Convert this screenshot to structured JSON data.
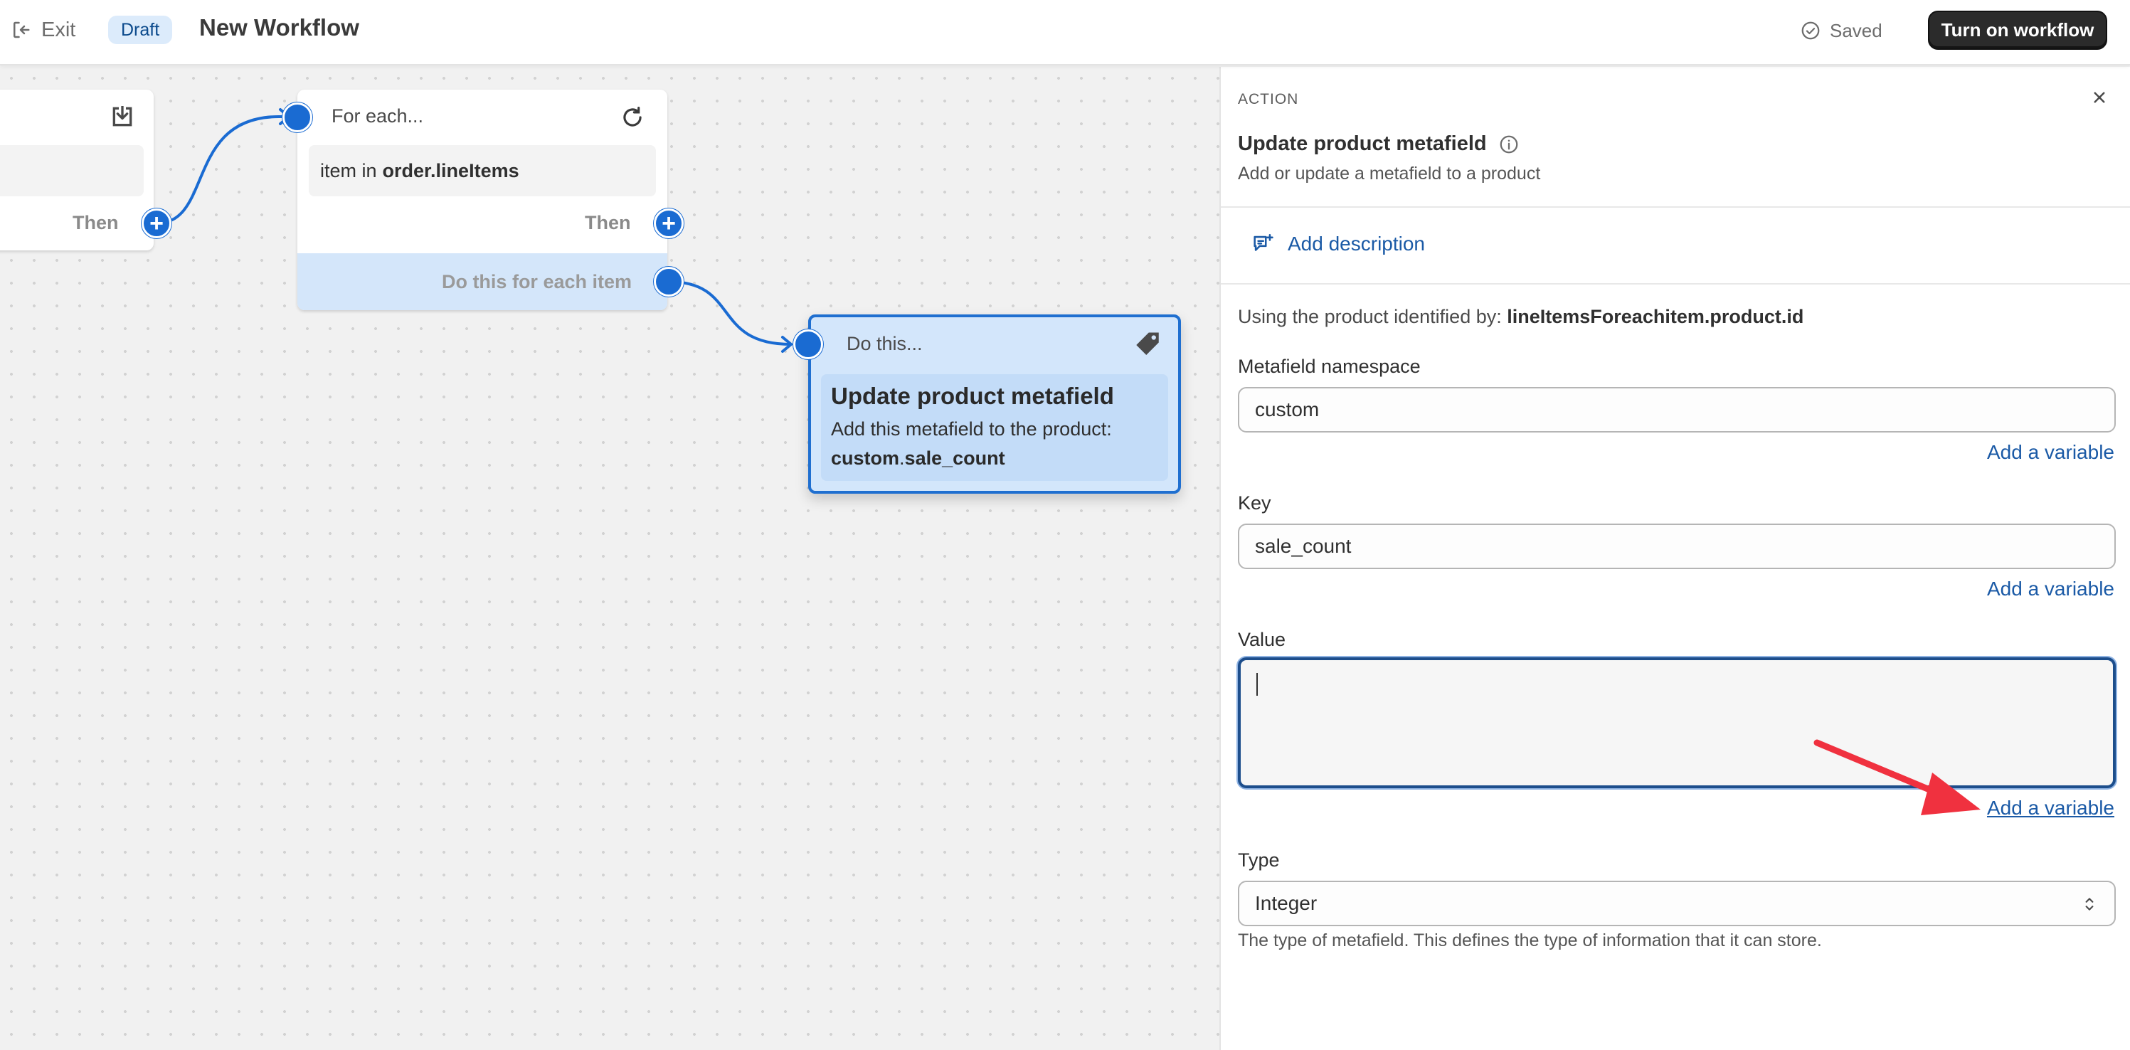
{
  "topbar": {
    "exit_label": "Exit",
    "status_badge": "Draft",
    "workflow_title": "New Workflow",
    "saved_label": "Saved",
    "turn_on_label": "Turn on workflow"
  },
  "canvas": {
    "trigger_card": {
      "then_label": "Then",
      "icon": "download-icon"
    },
    "foreach_card": {
      "heading": "For each...",
      "field_prefix": "item in",
      "field_value": "order.lineItems",
      "then_label": "Then",
      "each_item_label": "Do this for each item",
      "icon": "refresh-icon"
    },
    "action_card": {
      "heading": "Do this...",
      "title": "Update product metafield",
      "description": "Add this metafield to the product:",
      "key_namespace": "custom",
      "key_separator": ".",
      "key_name": "sale_count",
      "icon": "tag-icon"
    }
  },
  "panel": {
    "kicker": "ACTION",
    "title": "Update product metafield",
    "subtitle": "Add or update a metafield to a product",
    "add_description": "Add description",
    "using_prefix": "Using the product identified by:",
    "using_value": "lineItemsForeachitem.product.id",
    "namespace": {
      "label": "Metafield namespace",
      "value": "custom",
      "add_variable": "Add a variable"
    },
    "key": {
      "label": "Key",
      "value": "sale_count",
      "add_variable": "Add a variable"
    },
    "value_field": {
      "label": "Value",
      "value": "",
      "add_variable": "Add a variable"
    },
    "type": {
      "label": "Type",
      "selected": "Integer",
      "help": "The type of metafield. This defines the type of information that it can store."
    }
  },
  "colors": {
    "accent": "#1a6bd2",
    "link": "#1b5aa6",
    "annotation_arrow": "#f0313f",
    "primary_button": "#2b2b2b"
  }
}
